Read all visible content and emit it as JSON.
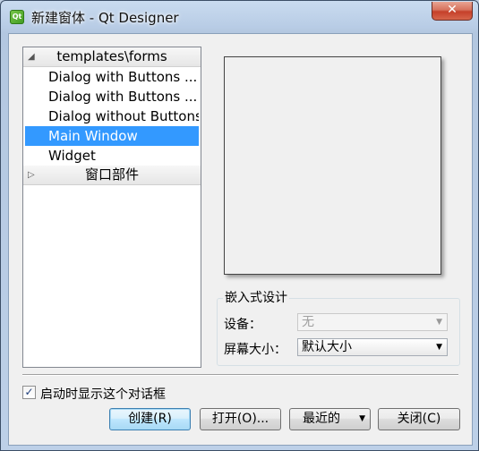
{
  "window": {
    "title": "新建窗体 - Qt Designer",
    "app_icon_text": "Qt",
    "close_symbol": "✕"
  },
  "tree": {
    "categories": [
      {
        "label": "templates\\forms",
        "expanded": true,
        "items": [
          {
            "label": "Dialog with Buttons ...",
            "selected": false
          },
          {
            "label": "Dialog with Buttons ...",
            "selected": false
          },
          {
            "label": "Dialog without Buttons",
            "selected": false
          },
          {
            "label": "Main Window",
            "selected": true
          },
          {
            "label": "Widget",
            "selected": false
          }
        ]
      },
      {
        "label": "窗口部件",
        "expanded": false,
        "items": []
      }
    ],
    "expanded_arrow": "◢",
    "collapsed_arrow": "▷"
  },
  "embedded": {
    "group_title": "嵌入式设计",
    "device_label": "设备：",
    "device_value": "无",
    "screen_size_label": "屏幕大小：",
    "screen_size_value": "默认大小"
  },
  "startup": {
    "checkbox_label": "启动时显示这个对话框",
    "checked": true,
    "check_mark": "✓"
  },
  "buttons": {
    "create": "创建(R)",
    "open": "打开(O)...",
    "recent": "最近的",
    "recent_arrow": "▼",
    "close": "关闭(C)"
  },
  "colors": {
    "selection": "#3399ff",
    "title_bar": "#b9cde6",
    "close_button": "#c5402a"
  }
}
